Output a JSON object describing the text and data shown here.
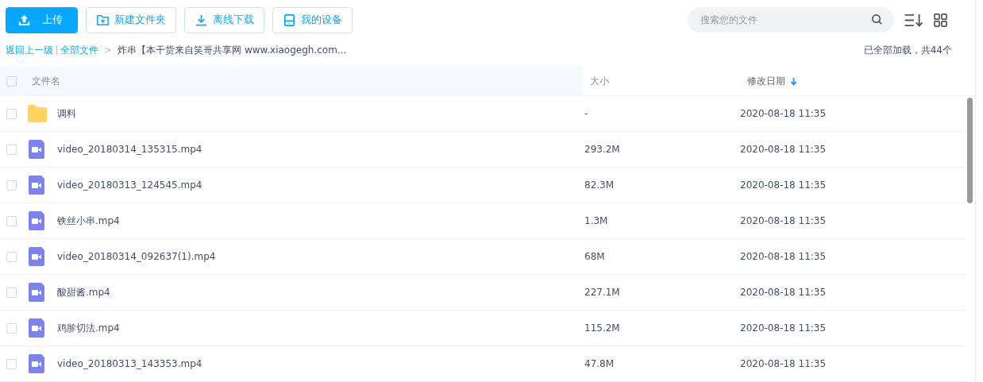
{
  "toolbar": {
    "buttons": [
      {
        "label": "上传",
        "kind": "upload",
        "primary": true
      },
      {
        "label": "新建文件夹",
        "kind": "folder",
        "primary": false
      },
      {
        "label": "离线下载",
        "kind": "download",
        "primary": false
      },
      {
        "label": "我的设备",
        "kind": "device",
        "primary": false
      }
    ],
    "search": {
      "placeholder": "搜索您的文件"
    }
  },
  "breadcrumb": {
    "back": "返回上一级",
    "root": "全部文件",
    "separator": ">",
    "current": "炸串【本干货来自笑哥共享网 www.xiaogegh.com..."
  },
  "load_status": "已全部加载，共44个",
  "table": {
    "select_all_checked": false,
    "columns": [
      {
        "label": "文件名",
        "sorted": false
      },
      {
        "label": "大小",
        "sorted": false
      },
      {
        "label": "修改日期",
        "sorted": true
      }
    ],
    "rows": [
      {
        "kind": "folder",
        "name": "调料",
        "size": "-",
        "date": "2020-08-18 11:35",
        "checked": false
      },
      {
        "kind": "video",
        "name": "video_20180314_135315.mp4",
        "size": "293.2M",
        "date": "2020-08-18 11:35",
        "checked": false
      },
      {
        "kind": "video",
        "name": "video_20180313_124545.mp4",
        "size": "82.3M",
        "date": "2020-08-18 11:35",
        "checked": false
      },
      {
        "kind": "video",
        "name": "铁丝小串.mp4",
        "size": "1.3M",
        "date": "2020-08-18 11:35",
        "checked": false
      },
      {
        "kind": "video",
        "name": "video_20180314_092637(1).mp4",
        "size": "68M",
        "date": "2020-08-18 11:35",
        "checked": false
      },
      {
        "kind": "video",
        "name": "酸甜酱.mp4",
        "size": "227.1M",
        "date": "2020-08-18 11:35",
        "checked": false
      },
      {
        "kind": "video",
        "name": "鸡胗切法.mp4",
        "size": "115.2M",
        "date": "2020-08-18 11:35",
        "checked": false
      },
      {
        "kind": "video",
        "name": "video_20180313_143353.mp4",
        "size": "47.8M",
        "date": "2020-08-18 11:35",
        "checked": false
      }
    ]
  }
}
